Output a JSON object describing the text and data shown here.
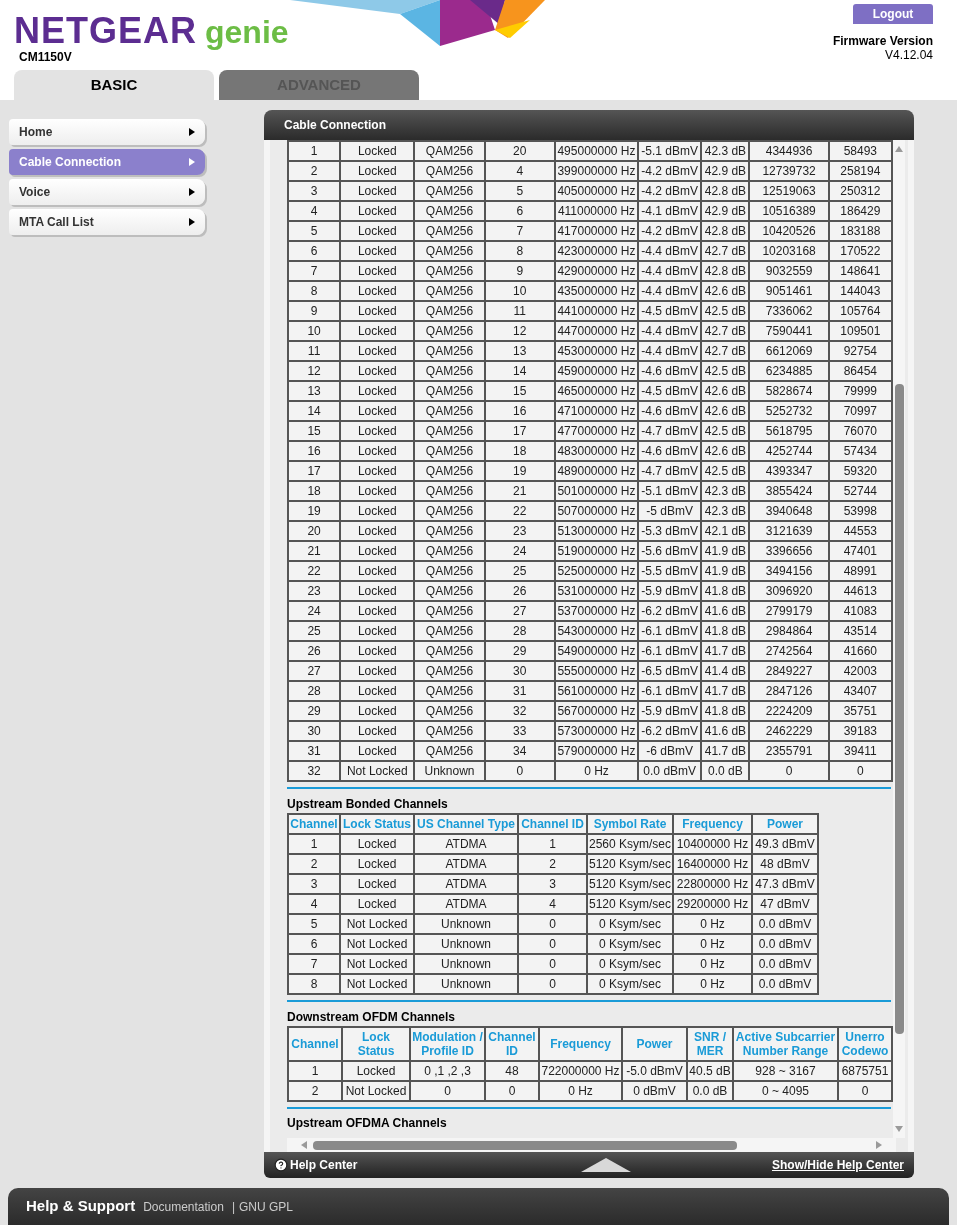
{
  "header": {
    "brand": "NETGEAR",
    "product": "genie",
    "model": "CM1150V",
    "logout": "Logout",
    "firmware_label": "Firmware Version",
    "firmware_value": "V4.12.04"
  },
  "tabs": [
    {
      "label": "BASIC",
      "selected": true
    },
    {
      "label": "ADVANCED",
      "selected": false
    }
  ],
  "sidebar": {
    "items": [
      {
        "label": "Home",
        "selected": false
      },
      {
        "label": "Cable Connection",
        "selected": true
      },
      {
        "label": "Voice",
        "selected": false
      },
      {
        "label": "MTA Call List",
        "selected": false
      }
    ]
  },
  "panel": {
    "title": "Cable Connection"
  },
  "downstream": {
    "rows": [
      [
        "1",
        "Locked",
        "QAM256",
        "20",
        "495000000 Hz",
        "-5.1 dBmV",
        "42.3 dB",
        "4344936",
        "58493"
      ],
      [
        "2",
        "Locked",
        "QAM256",
        "4",
        "399000000 Hz",
        "-4.2 dBmV",
        "42.9 dB",
        "12739732",
        "258194"
      ],
      [
        "3",
        "Locked",
        "QAM256",
        "5",
        "405000000 Hz",
        "-4.2 dBmV",
        "42.8 dB",
        "12519063",
        "250312"
      ],
      [
        "4",
        "Locked",
        "QAM256",
        "6",
        "411000000 Hz",
        "-4.1 dBmV",
        "42.9 dB",
        "10516389",
        "186429"
      ],
      [
        "5",
        "Locked",
        "QAM256",
        "7",
        "417000000 Hz",
        "-4.2 dBmV",
        "42.8 dB",
        "10420526",
        "183188"
      ],
      [
        "6",
        "Locked",
        "QAM256",
        "8",
        "423000000 Hz",
        "-4.4 dBmV",
        "42.7 dB",
        "10203168",
        "170522"
      ],
      [
        "7",
        "Locked",
        "QAM256",
        "9",
        "429000000 Hz",
        "-4.4 dBmV",
        "42.8 dB",
        "9032559",
        "148641"
      ],
      [
        "8",
        "Locked",
        "QAM256",
        "10",
        "435000000 Hz",
        "-4.4 dBmV",
        "42.6 dB",
        "9051461",
        "144043"
      ],
      [
        "9",
        "Locked",
        "QAM256",
        "11",
        "441000000 Hz",
        "-4.5 dBmV",
        "42.5 dB",
        "7336062",
        "105764"
      ],
      [
        "10",
        "Locked",
        "QAM256",
        "12",
        "447000000 Hz",
        "-4.4 dBmV",
        "42.7 dB",
        "7590441",
        "109501"
      ],
      [
        "11",
        "Locked",
        "QAM256",
        "13",
        "453000000 Hz",
        "-4.4 dBmV",
        "42.7 dB",
        "6612069",
        "92754"
      ],
      [
        "12",
        "Locked",
        "QAM256",
        "14",
        "459000000 Hz",
        "-4.6 dBmV",
        "42.5 dB",
        "6234885",
        "86454"
      ],
      [
        "13",
        "Locked",
        "QAM256",
        "15",
        "465000000 Hz",
        "-4.5 dBmV",
        "42.6 dB",
        "5828674",
        "79999"
      ],
      [
        "14",
        "Locked",
        "QAM256",
        "16",
        "471000000 Hz",
        "-4.6 dBmV",
        "42.6 dB",
        "5252732",
        "70997"
      ],
      [
        "15",
        "Locked",
        "QAM256",
        "17",
        "477000000 Hz",
        "-4.7 dBmV",
        "42.5 dB",
        "5618795",
        "76070"
      ],
      [
        "16",
        "Locked",
        "QAM256",
        "18",
        "483000000 Hz",
        "-4.6 dBmV",
        "42.6 dB",
        "4252744",
        "57434"
      ],
      [
        "17",
        "Locked",
        "QAM256",
        "19",
        "489000000 Hz",
        "-4.7 dBmV",
        "42.5 dB",
        "4393347",
        "59320"
      ],
      [
        "18",
        "Locked",
        "QAM256",
        "21",
        "501000000 Hz",
        "-5.1 dBmV",
        "42.3 dB",
        "3855424",
        "52744"
      ],
      [
        "19",
        "Locked",
        "QAM256",
        "22",
        "507000000 Hz",
        "-5 dBmV",
        "42.3 dB",
        "3940648",
        "53998"
      ],
      [
        "20",
        "Locked",
        "QAM256",
        "23",
        "513000000 Hz",
        "-5.3 dBmV",
        "42.1 dB",
        "3121639",
        "44553"
      ],
      [
        "21",
        "Locked",
        "QAM256",
        "24",
        "519000000 Hz",
        "-5.6 dBmV",
        "41.9 dB",
        "3396656",
        "47401"
      ],
      [
        "22",
        "Locked",
        "QAM256",
        "25",
        "525000000 Hz",
        "-5.5 dBmV",
        "41.9 dB",
        "3494156",
        "48991"
      ],
      [
        "23",
        "Locked",
        "QAM256",
        "26",
        "531000000 Hz",
        "-5.9 dBmV",
        "41.8 dB",
        "3096920",
        "44613"
      ],
      [
        "24",
        "Locked",
        "QAM256",
        "27",
        "537000000 Hz",
        "-6.2 dBmV",
        "41.6 dB",
        "2799179",
        "41083"
      ],
      [
        "25",
        "Locked",
        "QAM256",
        "28",
        "543000000 Hz",
        "-6.1 dBmV",
        "41.8 dB",
        "2984864",
        "43514"
      ],
      [
        "26",
        "Locked",
        "QAM256",
        "29",
        "549000000 Hz",
        "-6.1 dBmV",
        "41.7 dB",
        "2742564",
        "41660"
      ],
      [
        "27",
        "Locked",
        "QAM256",
        "30",
        "555000000 Hz",
        "-6.5 dBmV",
        "41.4 dB",
        "2849227",
        "42003"
      ],
      [
        "28",
        "Locked",
        "QAM256",
        "31",
        "561000000 Hz",
        "-6.1 dBmV",
        "41.7 dB",
        "2847126",
        "43407"
      ],
      [
        "29",
        "Locked",
        "QAM256",
        "32",
        "567000000 Hz",
        "-5.9 dBmV",
        "41.8 dB",
        "2224209",
        "35751"
      ],
      [
        "30",
        "Locked",
        "QAM256",
        "33",
        "573000000 Hz",
        "-6.2 dBmV",
        "41.6 dB",
        "2462229",
        "39183"
      ],
      [
        "31",
        "Locked",
        "QAM256",
        "34",
        "579000000 Hz",
        "-6 dBmV",
        "41.7 dB",
        "2355791",
        "39411"
      ],
      [
        "32",
        "Not Locked",
        "Unknown",
        "0",
        "0 Hz",
        "0.0 dBmV",
        "0.0 dB",
        "0",
        "0"
      ]
    ]
  },
  "upstream": {
    "title": "Upstream Bonded Channels",
    "columns": [
      "Channel",
      "Lock Status",
      "US Channel Type",
      "Channel ID",
      "Symbol Rate",
      "Frequency",
      "Power"
    ],
    "rows": [
      [
        "1",
        "Locked",
        "ATDMA",
        "1",
        "2560 Ksym/sec",
        "10400000 Hz",
        "49.3 dBmV"
      ],
      [
        "2",
        "Locked",
        "ATDMA",
        "2",
        "5120 Ksym/sec",
        "16400000 Hz",
        "48 dBmV"
      ],
      [
        "3",
        "Locked",
        "ATDMA",
        "3",
        "5120 Ksym/sec",
        "22800000 Hz",
        "47.3 dBmV"
      ],
      [
        "4",
        "Locked",
        "ATDMA",
        "4",
        "5120 Ksym/sec",
        "29200000 Hz",
        "47 dBmV"
      ],
      [
        "5",
        "Not Locked",
        "Unknown",
        "0",
        "0 Ksym/sec",
        "0 Hz",
        "0.0 dBmV"
      ],
      [
        "6",
        "Not Locked",
        "Unknown",
        "0",
        "0 Ksym/sec",
        "0 Hz",
        "0.0 dBmV"
      ],
      [
        "7",
        "Not Locked",
        "Unknown",
        "0",
        "0 Ksym/sec",
        "0 Hz",
        "0.0 dBmV"
      ],
      [
        "8",
        "Not Locked",
        "Unknown",
        "0",
        "0 Ksym/sec",
        "0 Hz",
        "0.0 dBmV"
      ]
    ]
  },
  "ofdm": {
    "title": "Downstream OFDM Channels",
    "columns": [
      "Channel",
      "Lock Status",
      "Modulation / Profile ID",
      "Channel ID",
      "Frequency",
      "Power",
      "SNR / MER",
      "Active Subcarrier Number Range",
      "Unerro Codewo"
    ],
    "rows": [
      [
        "1",
        "Locked",
        "0 ,1 ,2 ,3",
        "48",
        "722000000 Hz",
        "-5.0 dBmV",
        "40.5 dB",
        "928 ~ 3167",
        "6875751"
      ],
      [
        "2",
        "Not Locked",
        "0",
        "0",
        "0 Hz",
        "0 dBmV",
        "0.0 dB",
        "0 ~ 4095",
        "0"
      ]
    ]
  },
  "next_section_title": "Upstream OFDMA Channels",
  "help_bar": {
    "label": "Help Center",
    "toggle": "Show/Hide Help Center"
  },
  "footer": {
    "title": "Help & Support",
    "links": [
      "Documentation",
      "GNU GPL"
    ],
    "separator": "|"
  }
}
